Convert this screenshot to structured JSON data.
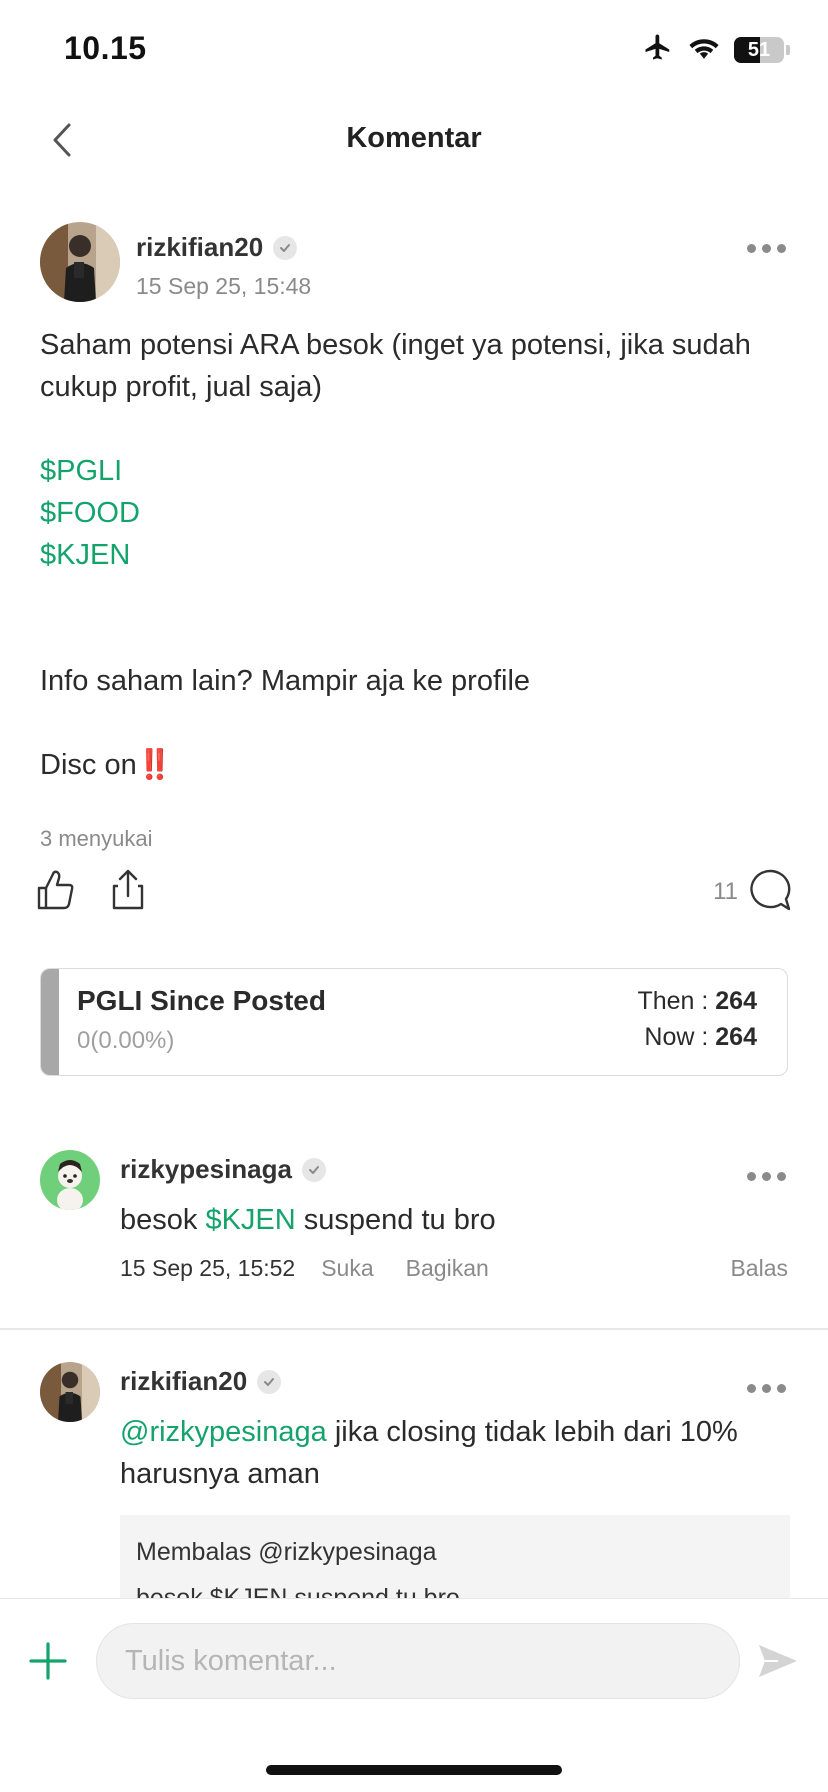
{
  "status_bar": {
    "time": "10.15",
    "battery": "51"
  },
  "nav": {
    "title": "Komentar"
  },
  "post": {
    "username": "rizkifian20",
    "timestamp": "15 Sep 25, 15:48",
    "text_intro": "Saham potensi ARA besok (inget ya potensi, jika sudah cukup profit, jual saja)",
    "tickers": [
      "$PGLI",
      "$FOOD",
      "$KJEN"
    ],
    "text_info": "Info saham lain? Mampir aja ke profile",
    "text_disc": "Disc on",
    "text_disc_emoji": "‼️",
    "likes_label": "3 menyukai",
    "comment_count": "11"
  },
  "stock_card": {
    "title": "PGLI Since Posted",
    "change": "0(0.00%)",
    "then_label": "Then : ",
    "then_value": "264",
    "now_label": "Now : ",
    "now_value": "264"
  },
  "comments": [
    {
      "username": "rizkypesinaga",
      "text_before": "besok ",
      "ticker": "$KJEN",
      "text_after": " suspend tu bro",
      "timestamp": "15 Sep 25, 15:52",
      "like_label": "Suka",
      "share_label": "Bagikan",
      "reply_label": "Balas"
    },
    {
      "username": "rizkifian20",
      "mention": "@rizkypesinaga",
      "text_after": " jika closing tidak lebih dari 10% harusnya aman",
      "quote_label": "Membalas @rizkypesinaga",
      "quote_text": "besok $KJEN suspend tu bro"
    }
  ],
  "composer": {
    "placeholder": "Tulis komentar..."
  },
  "colors": {
    "accent_green": "#13a36b",
    "exclaim_red": "#e32119"
  }
}
